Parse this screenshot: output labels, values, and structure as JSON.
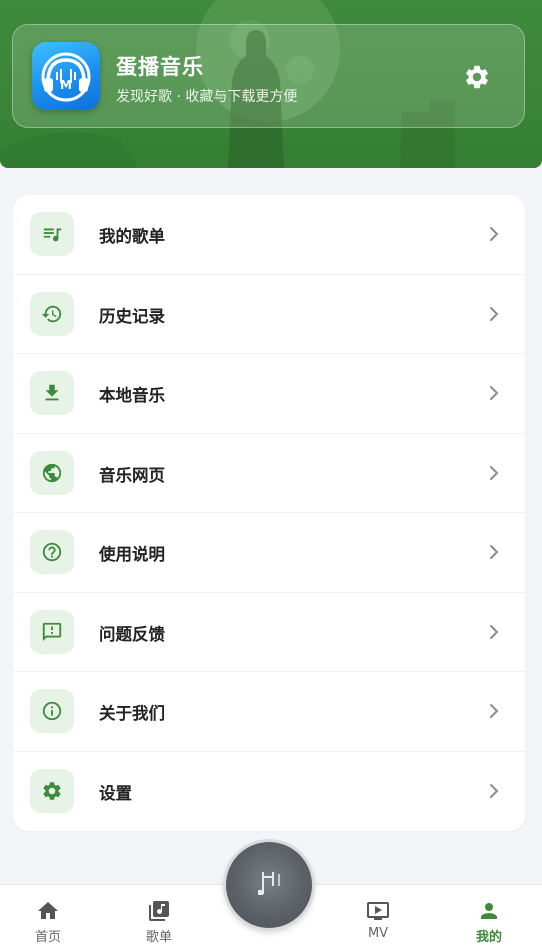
{
  "header": {
    "app_name": "蛋播音乐",
    "slogan": "发现好歌 · 收藏与下载更方便",
    "logo_text": "M",
    "settings_icon": "gear-icon"
  },
  "menu": {
    "items": [
      {
        "label": "我的歌单",
        "icon": "playlist-icon"
      },
      {
        "label": "历史记录",
        "icon": "history-icon"
      },
      {
        "label": "本地音乐",
        "icon": "download-icon"
      },
      {
        "label": "音乐网页",
        "icon": "globe-icon"
      },
      {
        "label": "使用说明",
        "icon": "help-icon"
      },
      {
        "label": "问题反馈",
        "icon": "feedback-icon"
      },
      {
        "label": "关于我们",
        "icon": "info-icon"
      },
      {
        "label": "设置",
        "icon": "gear-icon"
      }
    ]
  },
  "nav": {
    "items": [
      {
        "label": "首页",
        "icon": "home-icon",
        "active": false
      },
      {
        "label": "歌单",
        "icon": "music-library-icon",
        "active": false
      },
      {
        "label": "MV",
        "icon": "video-icon",
        "active": false
      },
      {
        "label": "我的",
        "icon": "person-icon",
        "active": true
      }
    ]
  },
  "colors": {
    "primary": "#3d8b3a",
    "header_bg": "#3a8537",
    "icon_bg": "#e8f3e7",
    "background": "#f4f5f8"
  }
}
